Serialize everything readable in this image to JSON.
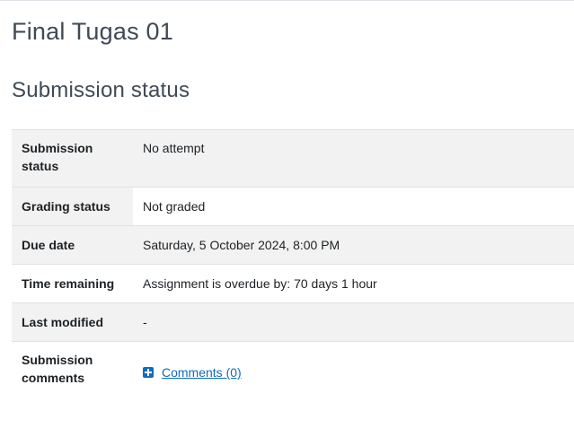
{
  "page": {
    "title": "Final Tugas 01",
    "section_title": "Submission status"
  },
  "status": {
    "submission_status": {
      "label": "Submission status",
      "value": "No attempt"
    },
    "grading_status": {
      "label": "Grading status",
      "value": "Not graded"
    },
    "due_date": {
      "label": "Due date",
      "value": "Saturday, 5 October 2024, 8:00 PM"
    },
    "time_remaining": {
      "label": "Time remaining",
      "value": "Assignment is overdue by: 70 days 1 hour"
    },
    "last_modified": {
      "label": "Last modified",
      "value": "-"
    },
    "submission_comments": {
      "label": "Submission comments",
      "link_text": "Comments (0)",
      "icon": "plus-square-icon"
    }
  },
  "colors": {
    "overdue": "#ca3120",
    "link": "#0f6cbf",
    "row_alt_bg": "#f2f2f2",
    "heading": "#3f4a55"
  }
}
